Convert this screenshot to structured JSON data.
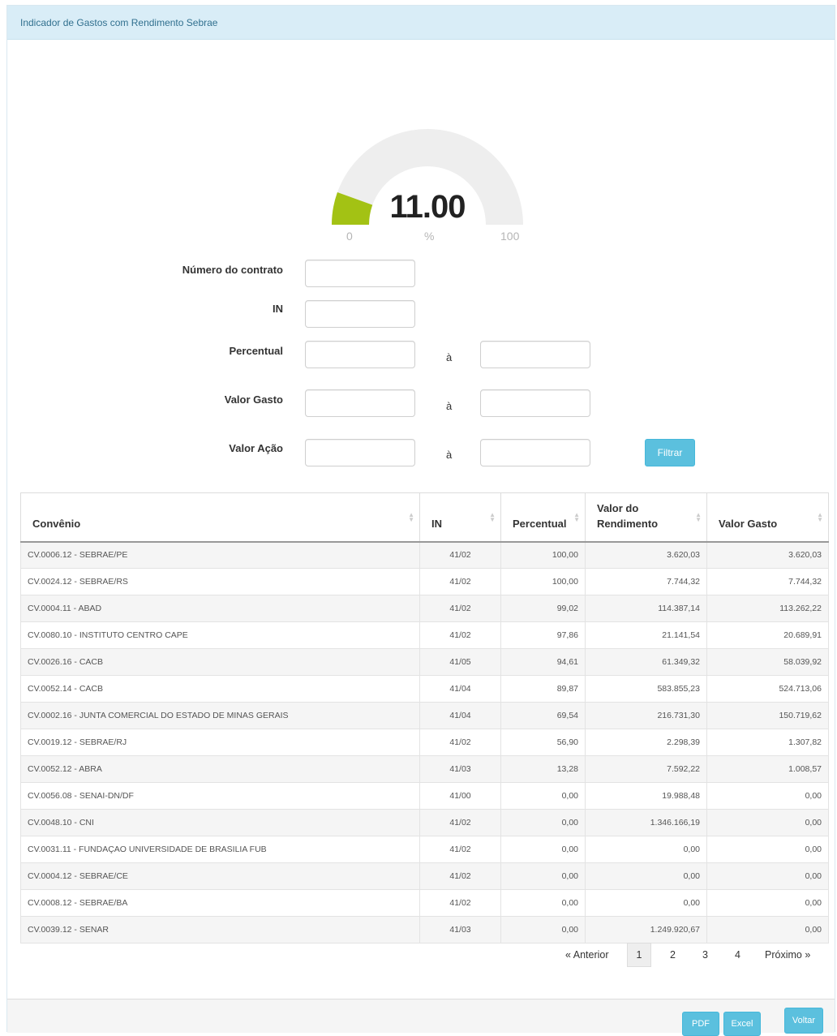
{
  "header": {
    "title": "Indicador de Gastos com Rendimento Sebrae"
  },
  "gauge": {
    "value": 11.0,
    "display": "11.00",
    "min": "0",
    "max": "100",
    "unit": "%",
    "fill_color": "#a3c214",
    "track_color": "#eeeeee"
  },
  "form": {
    "contrato_label": "Número do contrato",
    "in_label": "IN",
    "percentual_label": "Percentual",
    "valor_gasto_label": "Valor Gasto",
    "valor_acao_label": "Valor Ação",
    "range_sep": "à",
    "filter_button": "Filtrar"
  },
  "table": {
    "columns": [
      "Convênio",
      "IN",
      "Percentual",
      "Valor do Rendimento",
      "Valor Gasto"
    ],
    "rows": [
      [
        "CV.0006.12 - SEBRAE/PE",
        "41/02",
        "100,00",
        "3.620,03",
        "3.620,03"
      ],
      [
        "CV.0024.12 - SEBRAE/RS",
        "41/02",
        "100,00",
        "7.744,32",
        "7.744,32"
      ],
      [
        "CV.0004.11 - ABAD",
        "41/02",
        "99,02",
        "114.387,14",
        "113.262,22"
      ],
      [
        "CV.0080.10 - INSTITUTO CENTRO CAPE",
        "41/02",
        "97,86",
        "21.141,54",
        "20.689,91"
      ],
      [
        "CV.0026.16 - CACB",
        "41/05",
        "94,61",
        "61.349,32",
        "58.039,92"
      ],
      [
        "CV.0052.14 - CACB",
        "41/04",
        "89,87",
        "583.855,23",
        "524.713,06"
      ],
      [
        "CV.0002.16 - JUNTA COMERCIAL DO ESTADO DE MINAS GERAIS",
        "41/04",
        "69,54",
        "216.731,30",
        "150.719,62"
      ],
      [
        "CV.0019.12 - SEBRAE/RJ",
        "41/02",
        "56,90",
        "2.298,39",
        "1.307,82"
      ],
      [
        "CV.0052.12 - ABRA",
        "41/03",
        "13,28",
        "7.592,22",
        "1.008,57"
      ],
      [
        "CV.0056.08 - SENAI-DN/DF",
        "41/00",
        "0,00",
        "19.988,48",
        "0,00"
      ],
      [
        "CV.0048.10 - CNI",
        "41/02",
        "0,00",
        "1.346.166,19",
        "0,00"
      ],
      [
        "CV.0031.11 - FUNDAÇAO UNIVERSIDADE DE BRASILIA FUB",
        "41/02",
        "0,00",
        "0,00",
        "0,00"
      ],
      [
        "CV.0004.12 - SEBRAE/CE",
        "41/02",
        "0,00",
        "0,00",
        "0,00"
      ],
      [
        "CV.0008.12 - SEBRAE/BA",
        "41/02",
        "0,00",
        "0,00",
        "0,00"
      ],
      [
        "CV.0039.12 - SENAR",
        "41/03",
        "0,00",
        "1.249.920,67",
        "0,00"
      ]
    ]
  },
  "pagination": {
    "prev": "« Anterior",
    "pages": [
      "1",
      "2",
      "3",
      "4"
    ],
    "active": "1",
    "next": "Próximo »"
  },
  "footer": {
    "pdf": "PDF",
    "excel": "Excel",
    "voltar": "Voltar"
  }
}
